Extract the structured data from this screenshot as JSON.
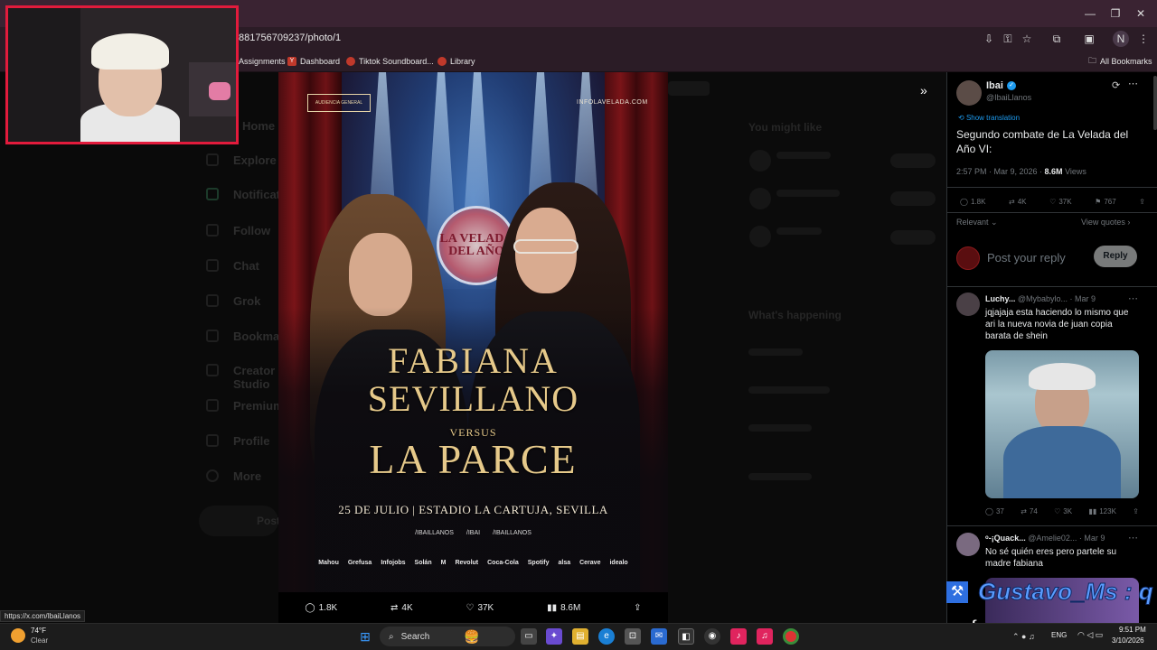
{
  "browser": {
    "url": "881756709237/photo/1",
    "bookmarks": [
      "Assignments",
      "Dashboard",
      "Tiktok Soundboard...",
      "Library"
    ],
    "all_bookmarks": "All Bookmarks",
    "profile_initial": "N",
    "status_url": "https://x.com/IbaiLlanos"
  },
  "poster": {
    "ticket_label": "AUDIENCIA GENERAL",
    "site": "INFOLAVELADA.COM",
    "seal": "LA VELADA DEL AÑO",
    "fighter1_line1": "FABIANA",
    "fighter1_line2": "SEVILLANO",
    "versus": "VERSUS",
    "fighter2": "LA PARCE",
    "date_venue": "25 DE JULIO | ESTADIO LA CARTUJA, SEVILLA",
    "socials": [
      "/IBAILLANOS",
      "/IBAI",
      "/IBAILLANOS"
    ],
    "sponsors": [
      "Mahou",
      "Grefusa",
      "Infojobs",
      "Solán",
      "M",
      "Revolut",
      "Coca-Cola",
      "Spotify",
      "alsa",
      "Cerave",
      "idealo"
    ]
  },
  "photo_actions": {
    "replies": "1.8K",
    "reposts": "4K",
    "likes": "37K",
    "views": "8.6M"
  },
  "tweet": {
    "author": "Ibai",
    "handle": "@IbaiLlanos",
    "show_translation": "Show translation",
    "text": "Segundo combate de La Velada del Año VI:",
    "time": "2:57 PM · Mar 9, 2026 · ",
    "views_count": "8.6M",
    "views_label": " Views",
    "replies": "1.8K",
    "reposts": "4K",
    "likes": "37K",
    "bookmarks": "767",
    "relevant": "Relevant",
    "view_quotes": "View quotes",
    "reply_placeholder": "Post your reply",
    "reply_button": "Reply"
  },
  "replies": [
    {
      "name": "Luchy...",
      "handle": "@Mybabylo...",
      "date": "· Mar 9",
      "text": "jqjajaja esta haciendo lo mismo que ari la nueva novia de juan copia barata de shein",
      "stats": {
        "replies": "37",
        "reposts": "74",
        "likes": "3K",
        "views": "123K"
      }
    },
    {
      "name": "ᵒ-¡Quack...",
      "handle": "@Amelie02...",
      "date": "· Mar 9",
      "text": "No sé quién eres pero partele su madre fabiana"
    }
  ],
  "sidebar_ghost": [
    "Home",
    "Explore",
    "Notifications",
    "Follow",
    "Chat",
    "Grok",
    "Bookmarks",
    "Creator Studio",
    "Premium",
    "Profile",
    "More",
    "Post"
  ],
  "right_ghost": {
    "you_might_like": "You might like",
    "whats_happening": "What's happening"
  },
  "overlay": {
    "name": "Gustavo_Ms : q",
    "sub": "gafo"
  },
  "taskbar": {
    "weather_temp": "74°F",
    "weather_desc": "Clear",
    "search": "Search",
    "lang": "ENG",
    "time": "9:51 PM",
    "date": "3/10/2026"
  }
}
